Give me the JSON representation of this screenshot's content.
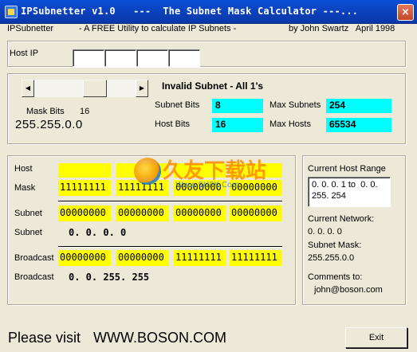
{
  "window": {
    "title": "IPSubnetter v1.0   ---  The Subnet Mask Calculator ---...",
    "close_label": "×"
  },
  "header": {
    "app_name": "IPSubnetter",
    "tagline": "- A FREE Utility to calculate IP Subnets -",
    "author": "by John Swartz   April 1998"
  },
  "host_ip": {
    "label": "Host IP",
    "octets": [
      "",
      "",
      "",
      ""
    ]
  },
  "mask_panel": {
    "scroll_left": "◀",
    "scroll_right": "▶",
    "mask_bits_label": "Mask Bits",
    "mask_bits_value": "16",
    "mask_value": "255.255.0.0",
    "status": "Invalid Subnet - All 1's",
    "subnet_bits_label": "Subnet Bits",
    "subnet_bits_value": "8",
    "host_bits_label": "Host Bits",
    "host_bits_value": "16",
    "max_subnets_label": "Max Subnets",
    "max_subnets_value": "254",
    "max_hosts_label": "Max Hosts",
    "max_hosts_value": "65534"
  },
  "binary": {
    "host_label": "Host",
    "mask_label": "Mask",
    "mask_octets": [
      "11111111",
      "11111111",
      "00000000",
      "00000000"
    ],
    "subnet_label": "Subnet",
    "subnet_octets": [
      "00000000",
      "00000000",
      "00000000",
      "00000000"
    ],
    "subnet_dec_label": "Subnet",
    "subnet_dec_value": "0. 0. 0. 0",
    "broadcast_label": "Broadcast",
    "broadcast_octets": [
      "00000000",
      "00000000",
      "11111111",
      "11111111"
    ],
    "broadcast_dec_label": "Broadcast",
    "broadcast_dec_value": "0. 0. 255. 255"
  },
  "right_panel": {
    "range_label": "Current Host Range",
    "range_value_1": "0. 0. 0. 1 to  0. 0.",
    "range_value_2": "255. 254",
    "network_label": "Current Network:",
    "network_value": "0. 0. 0. 0",
    "subnet_mask_label": "Subnet Mask:",
    "subnet_mask_value": "255.255.0.0",
    "comments_label": "Comments to:",
    "comments_value": "john@boson.com"
  },
  "footer": {
    "visit_text": "Please visit",
    "url_text": "WWW.BOSON.COM",
    "exit_label": "Exit"
  },
  "watermark": {
    "text": "久友下载站",
    "url": "Www.9UPK.Com"
  }
}
